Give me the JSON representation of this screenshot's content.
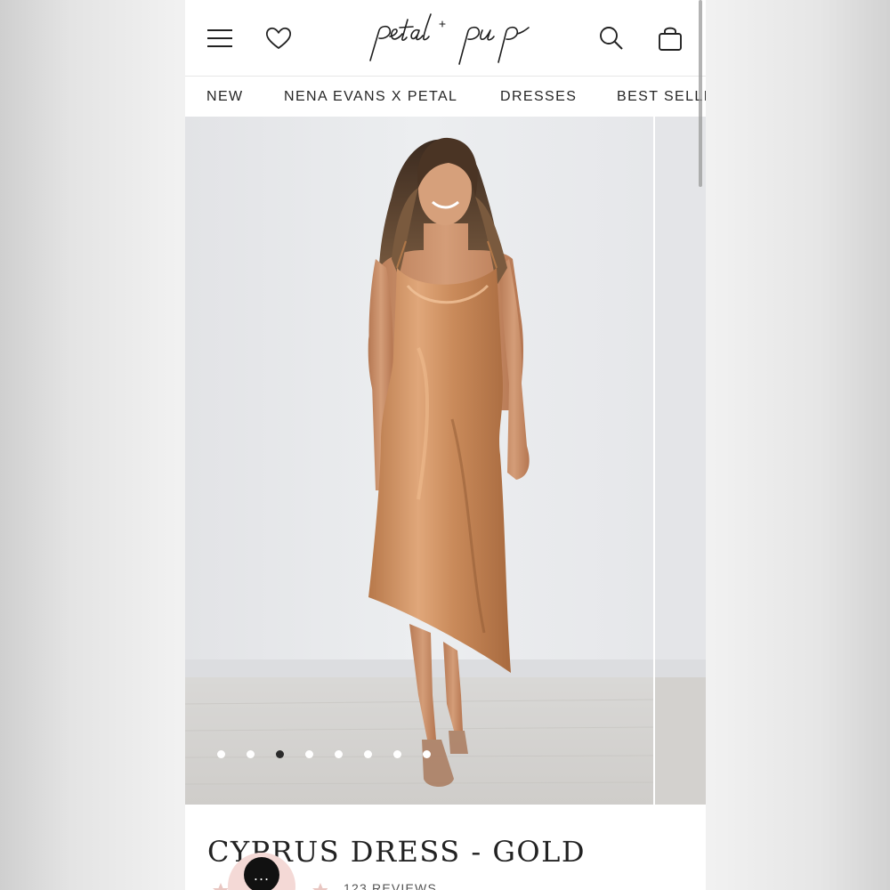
{
  "brand": {
    "logo_text": "petal + pup"
  },
  "header": {
    "menu_icon": "hamburger-menu-icon",
    "wishlist_icon": "heart-icon",
    "search_icon": "search-icon",
    "bag_icon": "shopping-bag-icon"
  },
  "nav": {
    "items": [
      "NEW",
      "NENA EVANS X PETAL",
      "DRESSES",
      "BEST SELLI"
    ]
  },
  "gallery": {
    "image_count": 8,
    "active_index": 2
  },
  "product": {
    "title": "CYPRUS DRESS - GOLD",
    "reviews_text": "123 REVIEWS"
  },
  "chat": {
    "icon": "chat-bubble-icon",
    "label": "..."
  },
  "colors": {
    "dress": "#c98a5a",
    "active_dot": "#2b2b2b",
    "chat_ring": "#f4d9d6"
  }
}
